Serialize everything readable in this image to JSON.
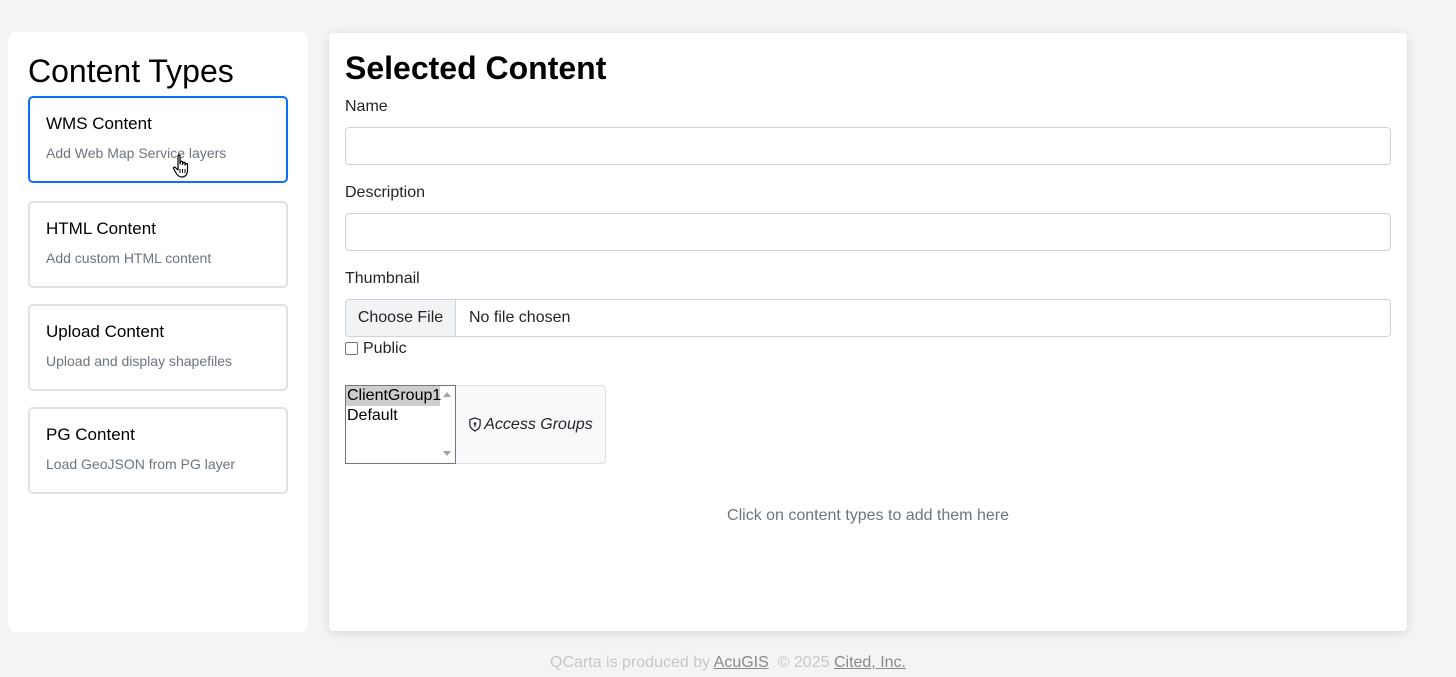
{
  "sidebar": {
    "title": "Content Types",
    "items": [
      {
        "title": "WMS Content",
        "desc": "Add Web Map Service layers"
      },
      {
        "title": "HTML Content",
        "desc": "Add custom HTML content"
      },
      {
        "title": "Upload Content",
        "desc": "Upload and display shapefiles"
      },
      {
        "title": "PG Content",
        "desc": "Load GeoJSON from PG layer"
      }
    ]
  },
  "main": {
    "title": "Selected Content",
    "name_label": "Name",
    "name_value": "",
    "description_label": "Description",
    "description_value": "",
    "thumbnail_label": "Thumbnail",
    "file_button": "Choose File",
    "file_status": "No file chosen",
    "public_label": "Public",
    "public_checked": false,
    "groups": {
      "options": [
        "ClientGroup1",
        "Default"
      ],
      "selected": "ClientGroup1",
      "label": "Access Groups",
      "icon": "shield-lock-icon"
    },
    "hint": "Click on content types to add them here"
  },
  "footer": {
    "text_prefix": "QCarta is produced by",
    "link1": "AcuGIS",
    "copyright": "© 2025",
    "link2": "Cited, Inc."
  },
  "colors": {
    "accent": "#0d6efd",
    "background": "#f4f4f4"
  }
}
